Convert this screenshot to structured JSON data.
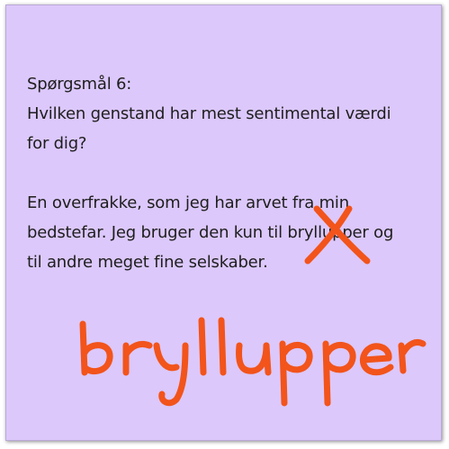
{
  "note": {
    "question_title": "Spørgsmål 6:",
    "question_line1": "Hvilken genstand har mest sentimental værdi",
    "question_line2": "for dig?",
    "answer_line1": "En overfrakke, som jeg har arvet fra min",
    "answer_line2": "bedstefar. Jeg bruger den kun til bryllupper og",
    "answer_line3": "til andre meget fine selskaber.",
    "handwritten_correction": "bryllupper",
    "ink_color": "#f2541b",
    "background_color": "#dcc8fb",
    "strike_icon": "cross-mark"
  }
}
